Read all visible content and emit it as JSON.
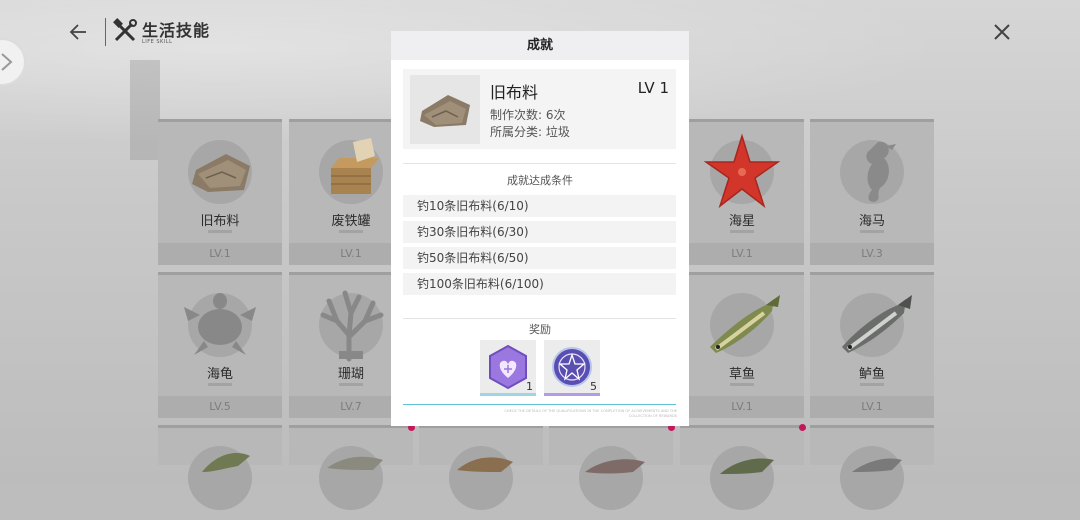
{
  "header": {
    "title": "生活技能",
    "subtitle": "LIFE SKILL"
  },
  "cards": [
    {
      "name": "旧布料",
      "level": "LV.1",
      "icon": "cloth-icon"
    },
    {
      "name": "废铁罐",
      "level": "LV.1",
      "icon": "iron-can-icon"
    },
    {
      "name": "海星",
      "level": "LV.1",
      "icon": "starfish-icon"
    },
    {
      "name": "海马",
      "level": "LV.3",
      "icon": "seahorse-icon"
    },
    {
      "name": "海龟",
      "level": "LV.5",
      "icon": "turtle-icon"
    },
    {
      "name": "珊瑚",
      "level": "LV.7",
      "icon": "coral-icon"
    },
    {
      "name": "草鱼",
      "level": "LV.1",
      "icon": "grass-carp-icon"
    },
    {
      "name": "鲈鱼",
      "level": "LV.1",
      "icon": "bass-icon"
    }
  ],
  "modal": {
    "title": "成就",
    "item": {
      "name": "旧布料",
      "level": "LV 1",
      "craft_count": "制作次数: 6次",
      "category": "所属分类:  垃圾"
    },
    "conditions_title": "成就达成条件",
    "conditions": [
      "钓10条旧布料(6/10)",
      "钓30条旧布料(6/30)",
      "钓50条旧布料(6/50)",
      "钓100条旧布料(6/100)"
    ],
    "rewards_title": "奖励",
    "rewards": [
      {
        "icon": "heart-hexagon-icon",
        "count": "1",
        "color": "#8e6bd6"
      },
      {
        "icon": "pentagram-orb-icon",
        "count": "5",
        "color": "#6a5bbf"
      }
    ],
    "fineprint": "CHECK THE DETAILS OF THE QUALIFICATIONS IN THE COMPLETION OF ACHIEVEMENTS AND THE COLLECTION OF REWARDS"
  },
  "colors": {
    "accent_line": "#5fc0d6",
    "notification_dot": "#c2185b"
  }
}
